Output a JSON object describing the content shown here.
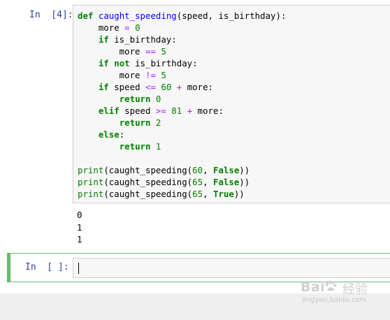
{
  "cell1": {
    "prompt": "In  [4]:",
    "code": [
      [
        {
          "t": "def",
          "c": "kw"
        },
        {
          "t": " "
        },
        {
          "t": "caught_speeding",
          "c": "fn"
        },
        {
          "t": "(speed, is_birthday):"
        }
      ],
      [
        {
          "t": "    more "
        },
        {
          "t": "=",
          "c": "op"
        },
        {
          "t": " "
        },
        {
          "t": "0",
          "c": "nm"
        }
      ],
      [
        {
          "t": "    "
        },
        {
          "t": "if",
          "c": "kw"
        },
        {
          "t": " is_birthday:"
        }
      ],
      [
        {
          "t": "        more "
        },
        {
          "t": "==",
          "c": "op"
        },
        {
          "t": " "
        },
        {
          "t": "5",
          "c": "nm"
        }
      ],
      [
        {
          "t": "    "
        },
        {
          "t": "if",
          "c": "kw"
        },
        {
          "t": " "
        },
        {
          "t": "not",
          "c": "kw"
        },
        {
          "t": " is_birthday:"
        }
      ],
      [
        {
          "t": "        more "
        },
        {
          "t": "!=",
          "c": "op"
        },
        {
          "t": " "
        },
        {
          "t": "5",
          "c": "nm"
        }
      ],
      [
        {
          "t": "    "
        },
        {
          "t": "if",
          "c": "kw"
        },
        {
          "t": " speed "
        },
        {
          "t": "<=",
          "c": "op"
        },
        {
          "t": " "
        },
        {
          "t": "60",
          "c": "nm"
        },
        {
          "t": " "
        },
        {
          "t": "+",
          "c": "op"
        },
        {
          "t": " more:"
        }
      ],
      [
        {
          "t": "        "
        },
        {
          "t": "return",
          "c": "kw"
        },
        {
          "t": " "
        },
        {
          "t": "0",
          "c": "nm"
        }
      ],
      [
        {
          "t": "    "
        },
        {
          "t": "elif",
          "c": "kw"
        },
        {
          "t": " speed "
        },
        {
          "t": ">=",
          "c": "op"
        },
        {
          "t": " "
        },
        {
          "t": "81",
          "c": "nm"
        },
        {
          "t": " "
        },
        {
          "t": "+",
          "c": "op"
        },
        {
          "t": " more:"
        }
      ],
      [
        {
          "t": "        "
        },
        {
          "t": "return",
          "c": "kw"
        },
        {
          "t": " "
        },
        {
          "t": "2",
          "c": "nm"
        }
      ],
      [
        {
          "t": "    "
        },
        {
          "t": "else",
          "c": "kw"
        },
        {
          "t": ":"
        }
      ],
      [
        {
          "t": "        "
        },
        {
          "t": "return",
          "c": "kw"
        },
        {
          "t": " "
        },
        {
          "t": "1",
          "c": "nm"
        }
      ],
      [
        {
          "t": ""
        }
      ],
      [
        {
          "t": "print",
          "c": "bi"
        },
        {
          "t": "(caught_speeding("
        },
        {
          "t": "60",
          "c": "nm"
        },
        {
          "t": ", "
        },
        {
          "t": "False",
          "c": "bl"
        },
        {
          "t": "))"
        }
      ],
      [
        {
          "t": "print",
          "c": "bi"
        },
        {
          "t": "(caught_speeding("
        },
        {
          "t": "65",
          "c": "nm"
        },
        {
          "t": ", "
        },
        {
          "t": "False",
          "c": "bl"
        },
        {
          "t": "))"
        }
      ],
      [
        {
          "t": "print",
          "c": "bi"
        },
        {
          "t": "(caught_speeding("
        },
        {
          "t": "65",
          "c": "nm"
        },
        {
          "t": ", "
        },
        {
          "t": "True",
          "c": "bl"
        },
        {
          "t": "))"
        }
      ]
    ],
    "output": [
      "0",
      "1",
      "1"
    ]
  },
  "cell2": {
    "prompt": "In  [ ]:",
    "value": ""
  },
  "watermark": {
    "logo": "Bai",
    "cn": "经验",
    "url": "jingyan.baidu.com"
  },
  "colors": {
    "prompt": "#303F9F",
    "keyword": "#008000",
    "function": "#0000FF",
    "operator": "#AA22FF",
    "active_cell_border": "#66BB6A"
  }
}
